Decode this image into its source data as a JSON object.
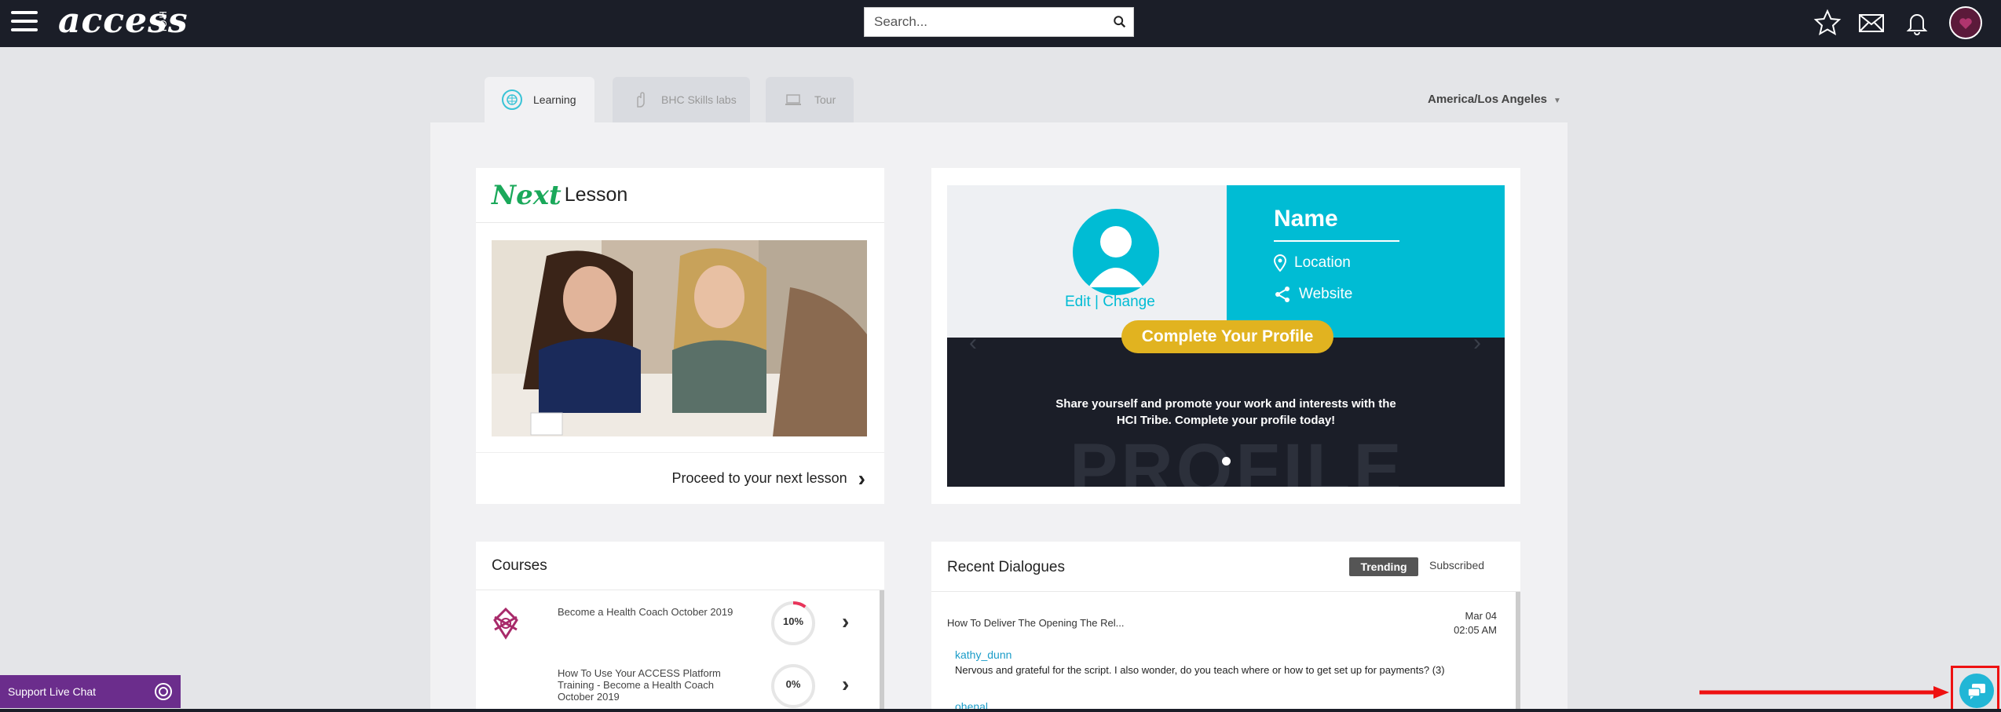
{
  "header": {
    "logo_text": "access",
    "logo_sub": "HCI",
    "search_placeholder": "Search..."
  },
  "tabs": [
    {
      "label": "Learning",
      "active": true
    },
    {
      "label": "BHC Skills labs",
      "active": false
    },
    {
      "label": "Tour",
      "active": false
    }
  ],
  "timezone": "America/Los Angeles",
  "next_lesson": {
    "next_word": "Next",
    "lesson_word": "Lesson",
    "proceed_label": "Proceed to your next lesson"
  },
  "profile_card": {
    "edit_change": "Edit | Change",
    "name": "Name",
    "location": "Location",
    "website": "Website",
    "cta": "Complete Your Profile",
    "description_line1": "Share yourself and promote your work and interests with the",
    "description_line2": "HCI Tribe. Complete your profile today!",
    "big_word": "PROFILE"
  },
  "courses": {
    "title": "Courses",
    "items": [
      {
        "title": "Become a Health Coach October 2019",
        "progress_label": "10%",
        "progress": 0.1
      },
      {
        "title": "How To Use Your ACCESS Platform Training - Become a Health Coach October 2019",
        "progress_label": "0%",
        "progress": 0.0
      }
    ]
  },
  "dialogues": {
    "title": "Recent Dialogues",
    "trending_label": "Trending",
    "subscribed_label": "Subscribed",
    "items": [
      {
        "topic": "How To Deliver The Opening The Rel...",
        "date": "Mar 04",
        "time": "02:05 AM",
        "user": "kathy_dunn",
        "message": "Nervous and grateful for the script. I also wonder, do you teach where or how to get set up for payments? (3)",
        "next_user": "ohenal"
      }
    ]
  },
  "support": {
    "live_chat_label": "Support Live Chat"
  },
  "colors": {
    "topbar": "#1b1e28",
    "accent_cyan": "#00bcd4",
    "cta_gold": "#e1b320",
    "live_chat_purple": "#6b2d8c",
    "next_green": "#1aa85a"
  }
}
